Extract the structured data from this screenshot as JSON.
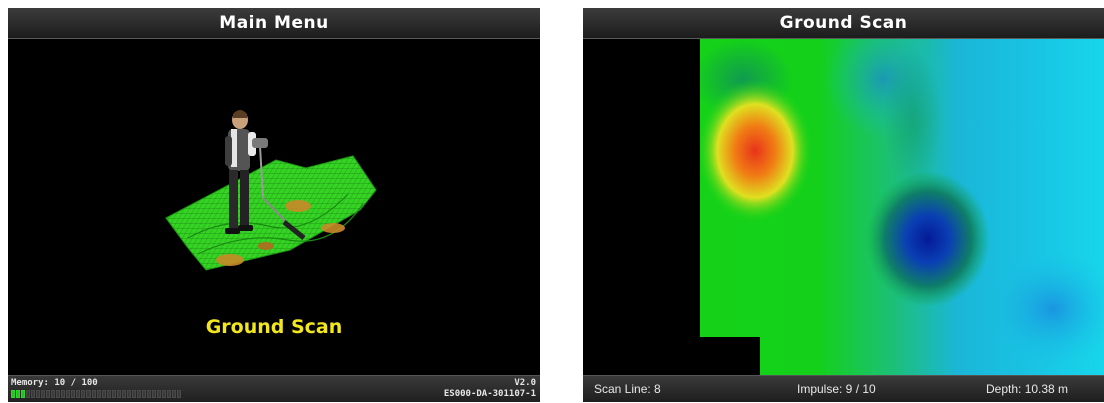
{
  "main_menu": {
    "title": "Main Menu",
    "selected_item": "Ground Scan",
    "memory_text": "Memory: 10 / 100",
    "memory_used": 10,
    "memory_total": 100,
    "version": "V2.0",
    "serial": "ES000-DA-301107-1"
  },
  "ground_scan": {
    "title": "Ground Scan",
    "scan_line_text": "Scan Line: 8",
    "impulse_text": "Impulse: 9 / 10",
    "depth_text": "Depth: 10.38 m"
  },
  "colors": {
    "label_yellow": "#f2e61c",
    "scan_green": "#16d316",
    "scan_cyan": "#17d3e6",
    "scan_red": "#e8331a",
    "scan_blue": "#0a1fa8"
  }
}
